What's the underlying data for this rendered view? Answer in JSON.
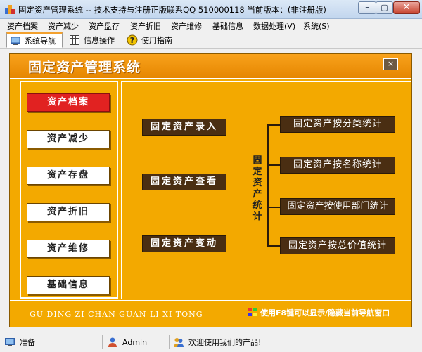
{
  "window": {
    "title": "固定资产管理系统 -- 技术支持与注册正版联系QQ 510000118    当前版本：(非注册版)"
  },
  "menu": {
    "items": [
      "资产档案",
      "资产减少",
      "资产盘存",
      "资产折旧",
      "资产维修",
      "基础信息",
      "数据处理(V)",
      "系统(S)"
    ]
  },
  "tabs": {
    "items": [
      {
        "label": "系统导航",
        "icon": "monitor-icon"
      },
      {
        "label": "信息操作",
        "icon": "grid-icon"
      },
      {
        "label": "使用指南",
        "icon": "help-icon"
      }
    ]
  },
  "main": {
    "title": "固定资产管理系统",
    "close_label": "×",
    "side_buttons": [
      "资产档案",
      "资产减少",
      "资产存盘",
      "资产折旧",
      "资产维修",
      "基础信息"
    ],
    "left_actions": [
      "固定资产录入",
      "固定资产查看",
      "固定资产变动"
    ],
    "stats_label": "固定资产统计",
    "stats_buttons": [
      "固定资产按分类统计",
      "固定资产按名称统计",
      "固定资产按使用部门统计",
      "固定资产按总价值统计"
    ],
    "pinyin": "GU DING ZI CHAN GUAN LI XI TONG",
    "hint": "使用F8键可以显示/隐藏当前导航窗口"
  },
  "status": {
    "ready": "准备",
    "user": "Admin",
    "welcome": "欢迎使用我们的产品!"
  },
  "colors": {
    "accent_orange": "#f3a900",
    "active_red": "#e12221",
    "dark_button": "#4a2e12"
  }
}
